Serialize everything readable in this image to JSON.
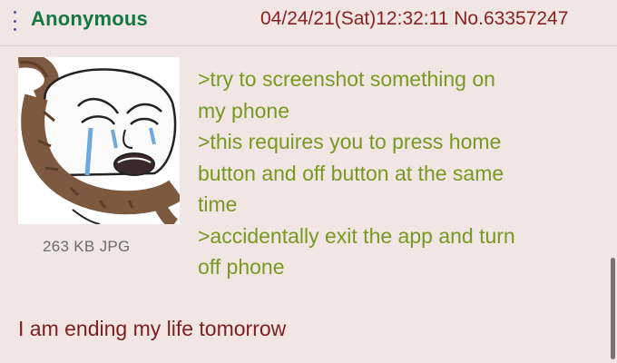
{
  "post": {
    "author": "Anonymous",
    "meta": "04/24/21(Sat)12:32:11 No.63357247",
    "file_info": "263 KB JPG",
    "greentext_lines": [
      ">try to screenshot something on",
      "my phone",
      ">this requires you to press home",
      "button and off button at the same",
      "time",
      ">accidentally exit the app and turn",
      "off phone"
    ],
    "body": "I am ending my life tomorrow"
  },
  "colors": {
    "background": "#f1e6e3",
    "author": "#117743",
    "greentext": "#789922",
    "meta": "#8b2222",
    "body": "#7b1f1f"
  },
  "icons": {
    "menu": "vertical-dots-icon",
    "thumbnail": "crying-wojak-noose-image"
  }
}
